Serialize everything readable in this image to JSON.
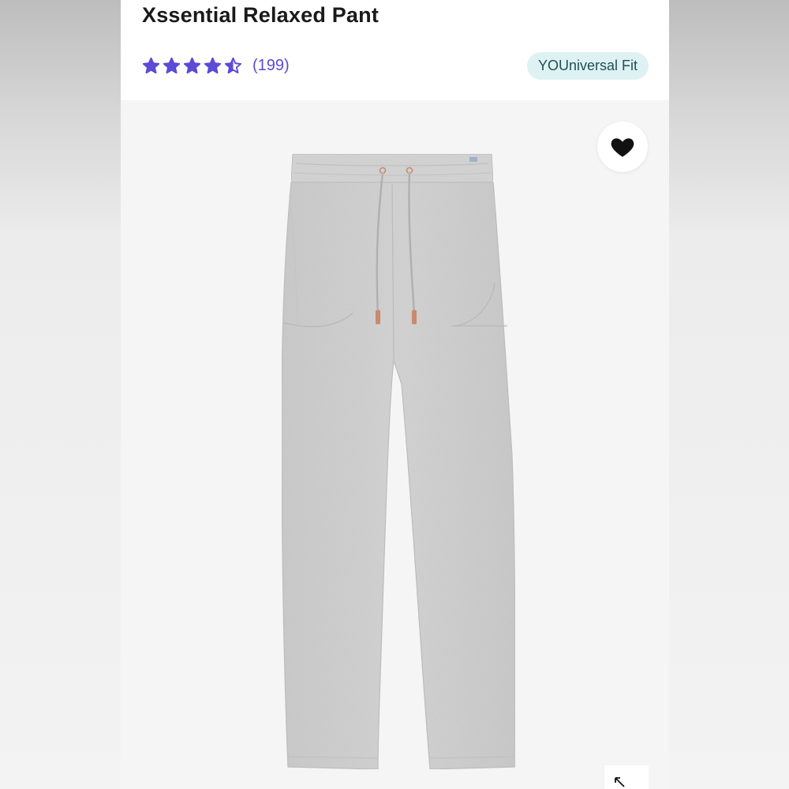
{
  "product": {
    "title": "Xssential Relaxed Pant",
    "rating": {
      "stars": 4.5,
      "max_stars": 5,
      "review_count": "(199)"
    },
    "fit_badge": "YOUniversal Fit"
  },
  "actions": {
    "wishlist_icon": "heart-icon",
    "expand_icon": "expand-arrow-icon"
  },
  "colors": {
    "star": "#5b4bd6",
    "review_count": "#5b4bd6",
    "badge_bg": "#dff2f3",
    "badge_text": "#1f4f57",
    "title": "#1a1a1a",
    "garment": "#cfcfcf",
    "cord_tip": "#c98a6e"
  }
}
